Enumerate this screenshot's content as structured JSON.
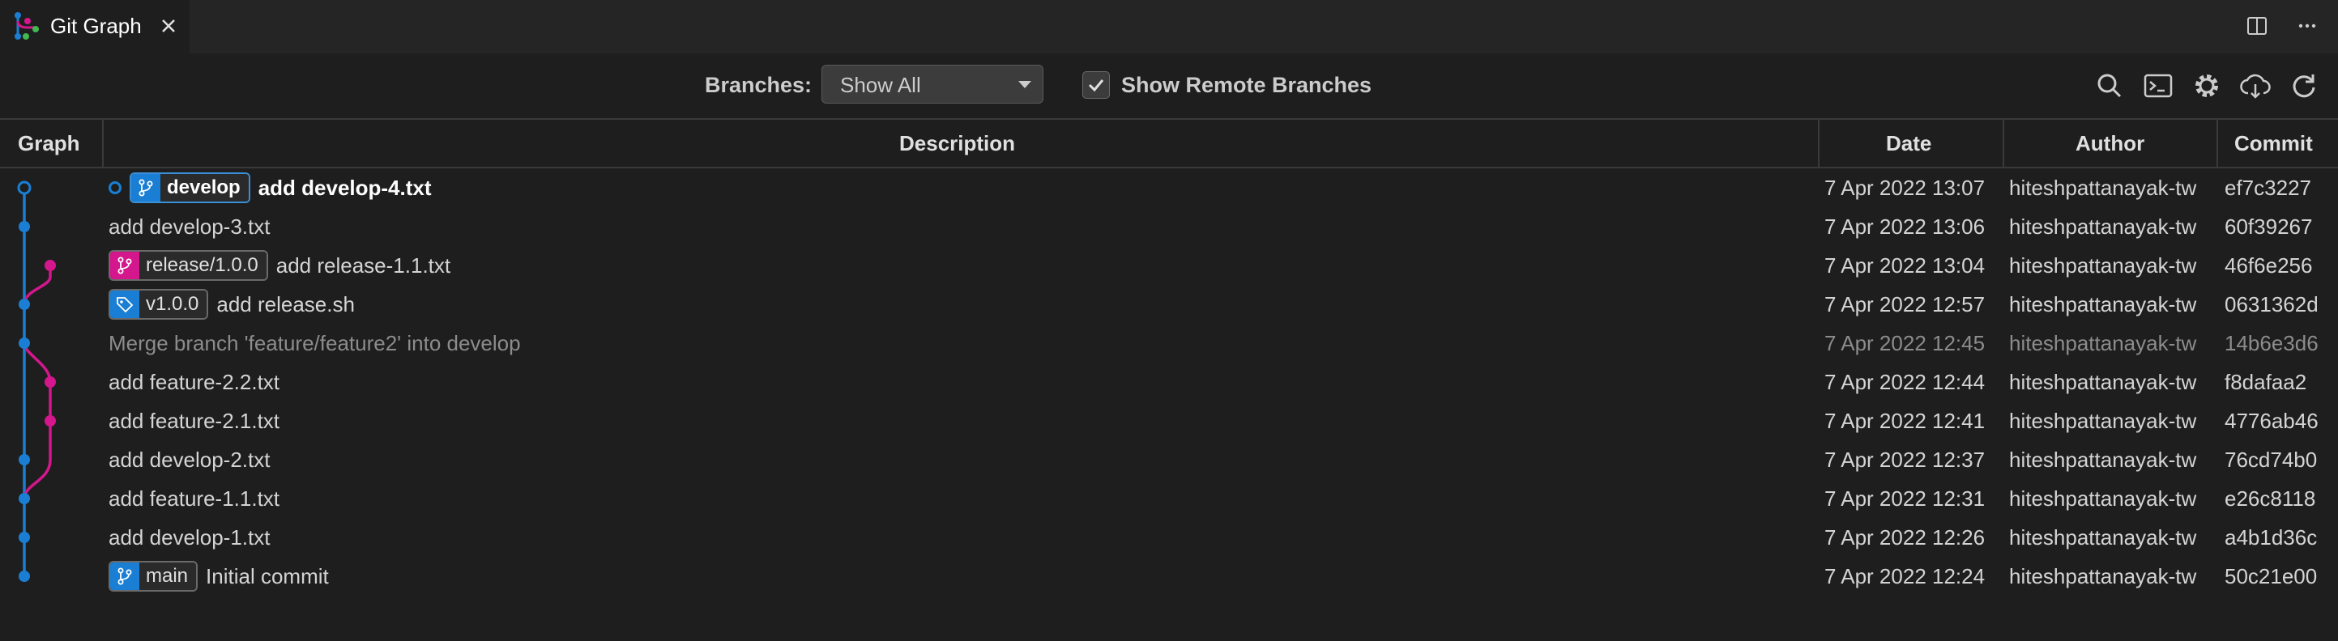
{
  "tab": {
    "title": "Git Graph",
    "icon": "git-graph-icon",
    "close_icon": "close-icon"
  },
  "editor_actions": [
    "split-editor-icon",
    "more-actions-icon"
  ],
  "controls": {
    "branches_label": "Branches:",
    "branches_value": "Show All",
    "show_remote_label": "Show Remote Branches",
    "show_remote_checked": true,
    "icons": [
      "search-icon",
      "terminal-icon",
      "settings-icon",
      "fetch-icon",
      "refresh-icon"
    ]
  },
  "columns": {
    "graph": "Graph",
    "description": "Description",
    "date": "Date",
    "author": "Author",
    "commit": "Commit"
  },
  "colors": {
    "develop": "#1a7fd4",
    "release": "#d4178c"
  },
  "commits": [
    {
      "refs": [
        {
          "name": "develop",
          "type": "branch",
          "color": "blue",
          "head": true
        }
      ],
      "message": "add develop-4.txt",
      "date": "7 Apr 2022 13:07",
      "author": "hiteshpattanayak-tw",
      "hash": "ef7c3227",
      "lane": 0
    },
    {
      "refs": [],
      "message": "add develop-3.txt",
      "date": "7 Apr 2022 13:06",
      "author": "hiteshpattanayak-tw",
      "hash": "60f39267",
      "lane": 0
    },
    {
      "refs": [
        {
          "name": "release/1.0.0",
          "type": "branch",
          "color": "pink"
        }
      ],
      "message": "add release-1.1.txt",
      "date": "7 Apr 2022 13:04",
      "author": "hiteshpattanayak-tw",
      "hash": "46f6e256",
      "lane": 1
    },
    {
      "refs": [
        {
          "name": "v1.0.0",
          "type": "tag",
          "color": "blue"
        }
      ],
      "message": "add release.sh",
      "date": "7 Apr 2022 12:57",
      "author": "hiteshpattanayak-tw",
      "hash": "0631362d",
      "lane": 0
    },
    {
      "refs": [],
      "message": "Merge branch 'feature/feature2' into develop",
      "date": "7 Apr 2022 12:45",
      "author": "hiteshpattanayak-tw",
      "hash": "14b6e3d6",
      "lane": 0,
      "merge": true
    },
    {
      "refs": [],
      "message": "add feature-2.2.txt",
      "date": "7 Apr 2022 12:44",
      "author": "hiteshpattanayak-tw",
      "hash": "f8dafaa2",
      "lane": 1
    },
    {
      "refs": [],
      "message": "add feature-2.1.txt",
      "date": "7 Apr 2022 12:41",
      "author": "hiteshpattanayak-tw",
      "hash": "4776ab46",
      "lane": 1
    },
    {
      "refs": [],
      "message": "add develop-2.txt",
      "date": "7 Apr 2022 12:37",
      "author": "hiteshpattanayak-tw",
      "hash": "76cd74b0",
      "lane": 0
    },
    {
      "refs": [],
      "message": "add feature-1.1.txt",
      "date": "7 Apr 2022 12:31",
      "author": "hiteshpattanayak-tw",
      "hash": "e26c8118",
      "lane": 0
    },
    {
      "refs": [],
      "message": "add develop-1.txt",
      "date": "7 Apr 2022 12:26",
      "author": "hiteshpattanayak-tw",
      "hash": "a4b1d36c",
      "lane": 0
    },
    {
      "refs": [
        {
          "name": "main",
          "type": "branch",
          "color": "blue"
        }
      ],
      "message": "Initial commit",
      "date": "7 Apr 2022 12:24",
      "author": "hiteshpattanayak-tw",
      "hash": "50c21e00",
      "lane": 0
    }
  ]
}
